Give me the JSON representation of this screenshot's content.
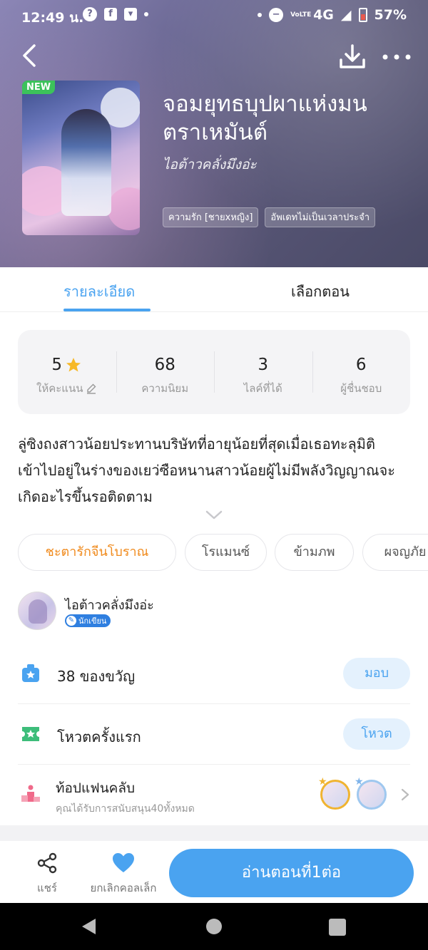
{
  "status_bar": {
    "time": "12:49 น.",
    "network": "4G",
    "volte": "VoLTE",
    "battery": "57%"
  },
  "book": {
    "badge": "NEW",
    "title": "จอมยุทธบุปผาแห่งมนตราเหมันต์",
    "author": "ไอต้าวคลั่งมึงอ่ะ",
    "tags": [
      "ความรัก [ชายxหญิง]",
      "อัพเดทไม่เป็นเวลาประจำ"
    ]
  },
  "tabs": {
    "details": "รายละเอียด",
    "chapters": "เลือกตอน"
  },
  "stats": [
    {
      "value": "5",
      "label": "ให้คะแนน"
    },
    {
      "value": "68",
      "label": "ความนิยม"
    },
    {
      "value": "3",
      "label": "ไลค์ที่ได้"
    },
    {
      "value": "6",
      "label": "ผู้ชื่นชอบ"
    }
  ],
  "description": "ลู่ซิงถงสาวน้อยประทานบริษัทที่อายุน้อยที่สุดเมื่อเธอทะลุมิติเข้าไปอยู่ในร่างของเยว่ซือหนานสาวน้อยผู้ไม่มีพลังวิญญาณจะเกิดอะไรขึ้นรอติดตาม",
  "genres": [
    "ชะตารักจีนโบราณ",
    "โรแมนซ์",
    "ข้ามภพ",
    "ผจญภัย"
  ],
  "author_card": {
    "name": "ไอต้าวคลั่งมึงอ่ะ",
    "badge": "นักเขียน"
  },
  "rows": {
    "gift": {
      "text": "38 ของขวัญ",
      "button": "มอบ"
    },
    "vote": {
      "text": "โหวตครั้งแรก",
      "button": "โหวต"
    },
    "fans": {
      "title": "ท้อปแฟนคลับ",
      "subtitle": "คุณได้รับการสนับสนุน40ทั้งหมด"
    }
  },
  "bottom": {
    "share": "แชร์",
    "favorite": "ยกเลิกคอลเล็ก",
    "read": "อ่านตอนที่1ต่อ"
  },
  "colors": {
    "accent": "#4aa3f0",
    "genre_highlight": "#f08a1c",
    "new_badge": "#3cc25b"
  }
}
